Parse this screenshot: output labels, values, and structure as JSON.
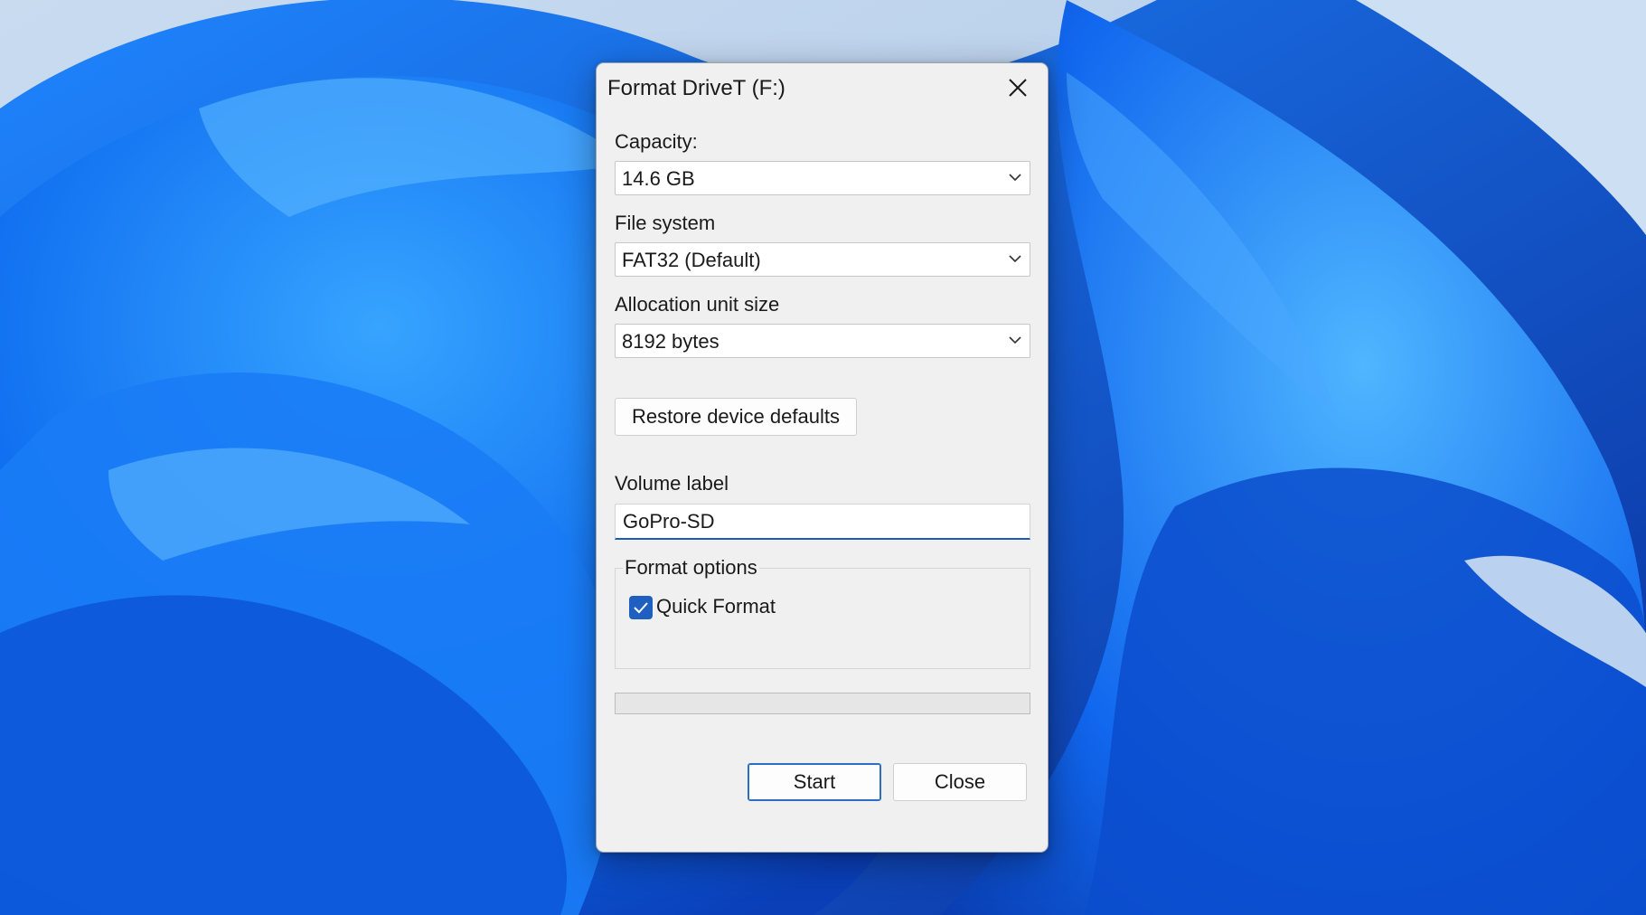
{
  "dialog": {
    "title": "Format DriveT (F:)",
    "capacity": {
      "label": "Capacity:",
      "value": "14.6 GB"
    },
    "file_system": {
      "label": "File system",
      "value": "FAT32 (Default)"
    },
    "allocation": {
      "label": "Allocation unit size",
      "value": "8192 bytes"
    },
    "restore_button": "Restore device defaults",
    "volume_label": {
      "label": "Volume label",
      "value": "GoPro-SD"
    },
    "format_options": {
      "legend": "Format options",
      "quick_format": {
        "label": "Quick Format",
        "checked": true
      }
    },
    "progress": 0,
    "buttons": {
      "start": "Start",
      "close": "Close"
    }
  },
  "colors": {
    "accent": "#1f5fbf",
    "dialog_bg": "#f0f0f0",
    "wallpaper_blue": "#0a5ee8"
  },
  "icons": {
    "close": "close-icon",
    "dropdown": "chevron-down-icon",
    "check": "checkmark-icon"
  }
}
